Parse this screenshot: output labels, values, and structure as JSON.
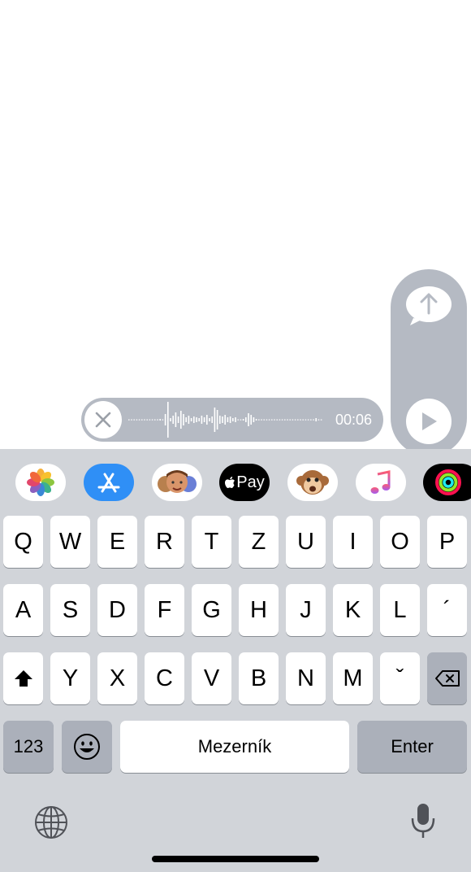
{
  "recording": {
    "duration": "00:06"
  },
  "app_strip": [
    {
      "name": "photos-app-icon"
    },
    {
      "name": "app-store-app-icon"
    },
    {
      "name": "memoji-stickers-app-icon"
    },
    {
      "name": "apple-pay-app-icon",
      "label": "Pay"
    },
    {
      "name": "animoji-app-icon"
    },
    {
      "name": "music-app-icon"
    },
    {
      "name": "activity-app-icon"
    }
  ],
  "keyboard": {
    "row1": [
      "Q",
      "W",
      "E",
      "R",
      "T",
      "Z",
      "U",
      "I",
      "O",
      "P"
    ],
    "row2": [
      "A",
      "S",
      "D",
      "F",
      "G",
      "H",
      "J",
      "K",
      "L",
      "´"
    ],
    "row3": [
      "Y",
      "X",
      "C",
      "V",
      "B",
      "N",
      "M",
      "ˇ"
    ],
    "numbers_label": "123",
    "space_label": "Mezerník",
    "enter_label": "Enter"
  },
  "colors": {
    "keyboard_bg": "#d1d4d9",
    "key_dark": "#abb0ba",
    "pill": "#b5bac3"
  }
}
